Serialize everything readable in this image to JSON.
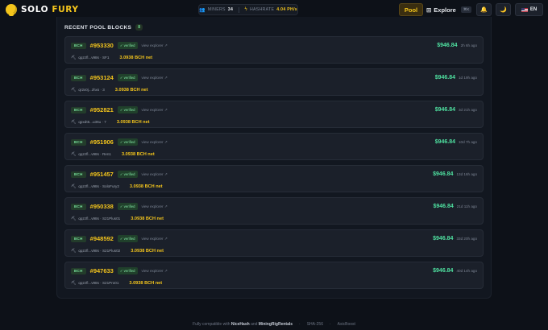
{
  "brand": {
    "name_primary": "SOLO",
    "name_accent": "FURY"
  },
  "stats": {
    "miners_label": "MINERS",
    "miners_value": "34",
    "hashrate_label": "HASHRATE",
    "hashrate_value": "4.04 PH/s"
  },
  "nav": {
    "pool": "Pool",
    "explore": "Explore",
    "explore_shortcut": "⌘K",
    "lang": "EN"
  },
  "icons": {
    "logo": "solofury-logo-icon",
    "miners": "miners-icon",
    "hashrate": "hashrate-icon",
    "bell": "bell-icon",
    "theme": "moon-icon",
    "flag": "us-flag-icon",
    "pickaxe": "pickaxe-icon",
    "external": "external-link-icon"
  },
  "colors": {
    "accent": "#f4c51c",
    "amount": "#4fe0a0",
    "verified": "#80e3a2",
    "background": "#0d1118"
  },
  "section": {
    "title": "RECENT POOL BLOCKS",
    "count": "8"
  },
  "blocks": [
    {
      "coin": "BCH",
      "height": "#953330",
      "status": "verified",
      "explorer": "view explorer ↗",
      "miner": "qqzzfl...v98s · SF1",
      "net": "3.0938 BCH net",
      "amount": "$946.84",
      "ago": "2h 6h ago"
    },
    {
      "coin": "BCH",
      "height": "#953124",
      "status": "verified",
      "explorer": "view explorer ↗",
      "miner": "qr2x0j...zhxs · 3",
      "net": "3.0938 BCH net",
      "amount": "$946.84",
      "ago": "1d 19h ago"
    },
    {
      "coin": "BCH",
      "height": "#952821",
      "status": "verified",
      "explorer": "view explorer ↗",
      "miner": "qpxdt5...u36u · 7",
      "net": "3.0938 BCH net",
      "amount": "$946.84",
      "ago": "3d 21h ago"
    },
    {
      "coin": "BCH",
      "height": "#951906",
      "status": "verified",
      "explorer": "view explorer ↗",
      "miner": "qqzzfl...v98s · Ren1",
      "net": "3.0938 BCH net",
      "amount": "$946.84",
      "ago": "10d 7h ago"
    },
    {
      "coin": "BCH",
      "height": "#951457",
      "status": "verified",
      "explorer": "view explorer ↗",
      "miner": "qqzzfl...v98s · SoloFury2",
      "net": "3.0938 BCH net",
      "amount": "$946.84",
      "ago": "13d 16h ago"
    },
    {
      "coin": "BCH",
      "height": "#950338",
      "status": "verified",
      "explorer": "view explorer ↗",
      "miner": "qqzzfl...v98s · S21Plus01",
      "net": "3.0938 BCH net",
      "amount": "$946.84",
      "ago": "21d 11h ago"
    },
    {
      "coin": "BCH",
      "height": "#948592",
      "status": "verified",
      "explorer": "view explorer ↗",
      "miner": "qqzzfl...v98s · S21Plus02",
      "net": "3.0938 BCH net",
      "amount": "$946.84",
      "ago": "33d 20h ago"
    },
    {
      "coin": "BCH",
      "height": "#947633",
      "status": "verified",
      "explorer": "view explorer ↗",
      "miner": "qqzzfl...v98s · S21Pro01",
      "net": "3.0938 BCH net",
      "amount": "$946.84",
      "ago": "40d 14h ago"
    }
  ],
  "footer": {
    "compat_prefix": "Fully compatible with",
    "nicehash": "NiceHash",
    "and": "and",
    "mrr": "MiningRigRentals",
    "algo": "SHA-256",
    "boost": "AsicBoost"
  }
}
